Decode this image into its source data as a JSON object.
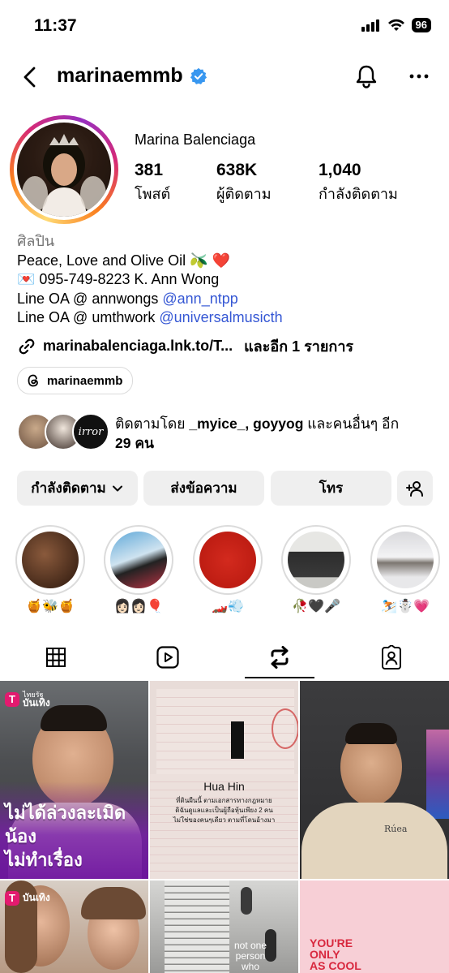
{
  "status": {
    "time": "11:37",
    "battery": "96"
  },
  "header": {
    "username": "marinaemmb"
  },
  "profile": {
    "display_name": "Marina Balenciaga",
    "stats": [
      {
        "value": "381",
        "label": "โพสต์"
      },
      {
        "value": "638K",
        "label": "ผู้ติดตาม"
      },
      {
        "value": "1,040",
        "label": "กำลังติดตาม"
      }
    ],
    "category": "ศิลปิน",
    "bio": {
      "line1": "Peace, Love and Olive Oil 🫒 ❤️",
      "line2": "💌 095-749-8223 K. Ann Wong",
      "line3_text": "Line OA @ annwongs ",
      "line3_mention": "@ann_ntpp",
      "line4_text": "Line OA @ umthwork ",
      "line4_mention": "@universalmusicth"
    },
    "link": {
      "text": "marinabalenciaga.lnk.to/T...",
      "more": "และอีก 1 รายการ"
    },
    "threads_handle": "marinaemmb"
  },
  "followed_by": {
    "line1_prefix": "ติดตามโดย ",
    "names": "_myice_, goyyog",
    "line1_suffix": " และคนอื่นๆ อีก",
    "line2": "29 คน",
    "third_avatar_text": "irror"
  },
  "actions": {
    "following": "กำลังติดตาม",
    "message": "ส่งข้อความ",
    "call": "โทร"
  },
  "highlights": [
    {
      "label": "🍯🐝🍯"
    },
    {
      "label": "👩🏻👩🏻🎈"
    },
    {
      "label": "🏎️💨"
    },
    {
      "label": "🥀🖤🎤"
    },
    {
      "label": "⛷️☃️💗"
    }
  ],
  "grid": {
    "tile1": {
      "brand": "บันเทิง",
      "brand_small": "ไทยรัฐ",
      "caption_line1": "ไม่ได้ล่วงละเมิดน้อง",
      "caption_line2": "ไม่ทำเรื่องขยะแขยง"
    },
    "tile2": {
      "place": "Hua Hin",
      "note1": "ที่ดินผืนนี้ ตามเอกสารทางกฎหมาย",
      "note2": "ดิฉันดูแลและเป็นผู้ถือหุ้นเพียง 2 คน",
      "note3": "ไม่ใช่ของคนๆเดียว ตามที่โดนอ้างมา"
    },
    "tile3": {
      "shirt_text": "Rúea"
    },
    "tile4": {
      "brand": "บันเทิง"
    },
    "tile5": {
      "line1": "not one",
      "line2": "person",
      "line3": "who"
    },
    "tile6": {
      "line1": "YOU'RE",
      "line2": "ONLY",
      "line3": "AS COOL"
    }
  }
}
